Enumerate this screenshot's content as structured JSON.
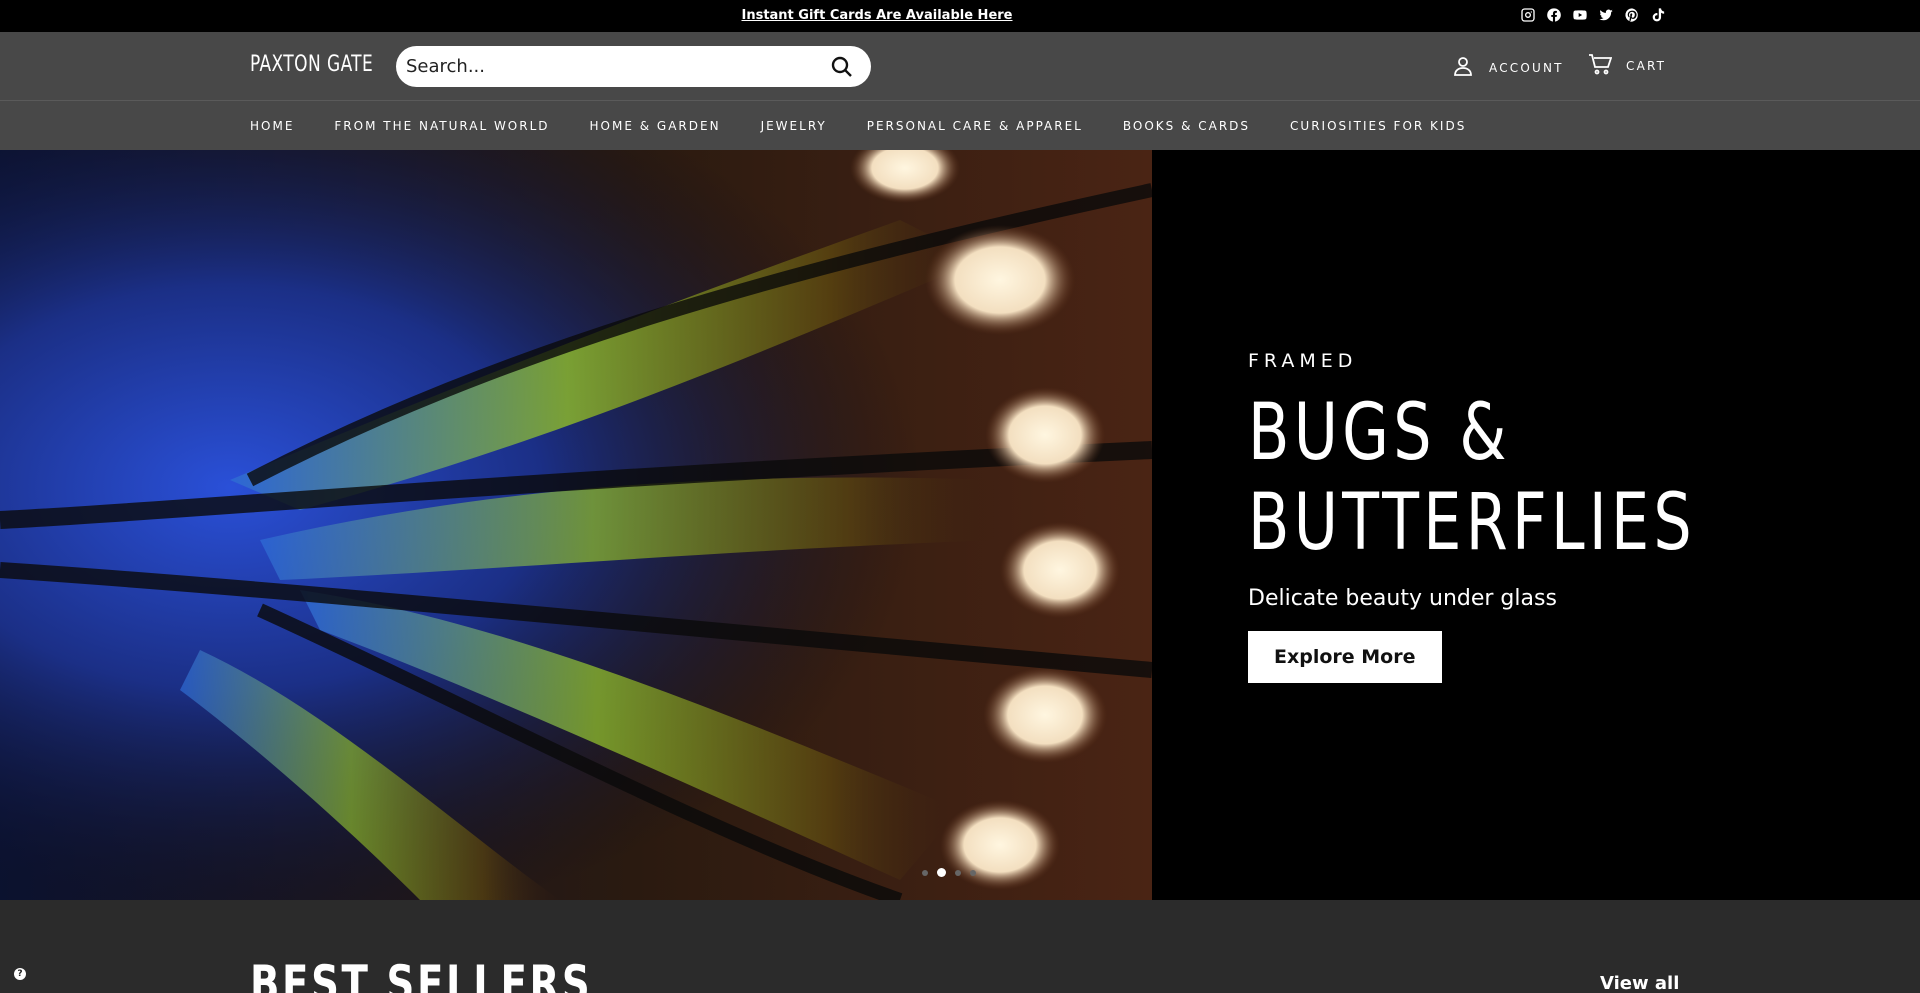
{
  "announcement": {
    "text": "Instant Gift Cards Are Available Here"
  },
  "social_icons": [
    "instagram-icon",
    "facebook-icon",
    "youtube-icon",
    "twitter-icon",
    "pinterest-icon",
    "tiktok-icon"
  ],
  "header": {
    "logo": "PAXTON GATE",
    "search_placeholder": "Search...",
    "account_label": "ACCOUNT",
    "cart_label": "CART"
  },
  "nav": {
    "items": [
      {
        "label": "HOME"
      },
      {
        "label": "FROM THE NATURAL WORLD"
      },
      {
        "label": "HOME & GARDEN"
      },
      {
        "label": "JEWELRY"
      },
      {
        "label": "PERSONAL CARE & APPAREL"
      },
      {
        "label": "BOOKS & CARDS"
      },
      {
        "label": "CURIOSITIES FOR KIDS"
      }
    ]
  },
  "hero": {
    "eyebrow": "FRAMED",
    "heading_line1": "BUGS &",
    "heading_line2": "BUTTERFLIES",
    "subtext": "Delicate beauty under glass",
    "cta_label": "Explore More",
    "slides_count": 4,
    "active_slide": 2
  },
  "best_sellers": {
    "title": "BEST SELLERS",
    "view_all": "View all"
  },
  "colors": {
    "header_bg": "#484848",
    "announcement_bg": "#000000",
    "section_bg": "#2b2b2b"
  }
}
